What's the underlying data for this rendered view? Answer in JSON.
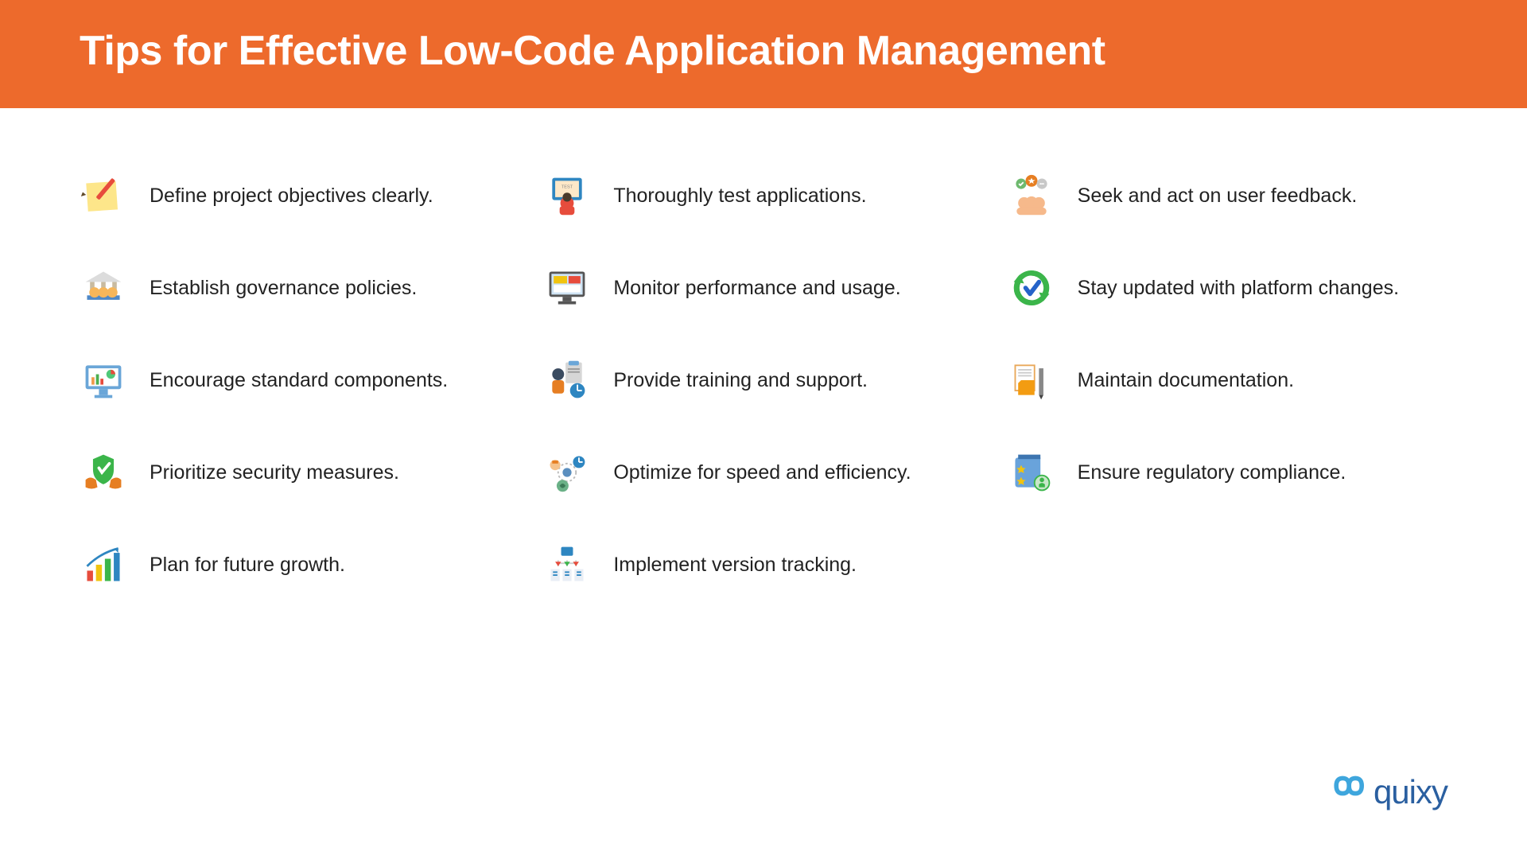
{
  "header": {
    "title": "Tips for Effective Low-Code Application Management"
  },
  "columns": [
    {
      "items": [
        {
          "icon": "note-pencil-icon",
          "text": "Define project objectives clearly."
        },
        {
          "icon": "governance-icon",
          "text": "Establish governance policies."
        },
        {
          "icon": "dashboard-icon",
          "text": "Encourage standard components."
        },
        {
          "icon": "shield-hands-icon",
          "text": "Prioritize security measures."
        },
        {
          "icon": "growth-chart-icon",
          "text": "Plan for future growth."
        }
      ]
    },
    {
      "items": [
        {
          "icon": "testing-icon",
          "text": "Thoroughly test applications."
        },
        {
          "icon": "monitor-icon",
          "text": "Monitor performance and usage."
        },
        {
          "icon": "training-icon",
          "text": "Provide training and support."
        },
        {
          "icon": "optimize-icon",
          "text": "Optimize for speed and efficiency."
        },
        {
          "icon": "version-tracking-icon",
          "text": "Implement version tracking."
        }
      ]
    },
    {
      "items": [
        {
          "icon": "feedback-icon",
          "text": "Seek and act on user feedback."
        },
        {
          "icon": "refresh-check-icon",
          "text": "Stay updated with platform changes."
        },
        {
          "icon": "document-folder-icon",
          "text": "Maintain documentation."
        },
        {
          "icon": "compliance-icon",
          "text": "Ensure regulatory compliance."
        }
      ]
    }
  ],
  "brand": {
    "name": "quixy"
  },
  "colors": {
    "accent": "#ED6A2C",
    "text": "#222222",
    "brand": "#2a5fa0"
  }
}
